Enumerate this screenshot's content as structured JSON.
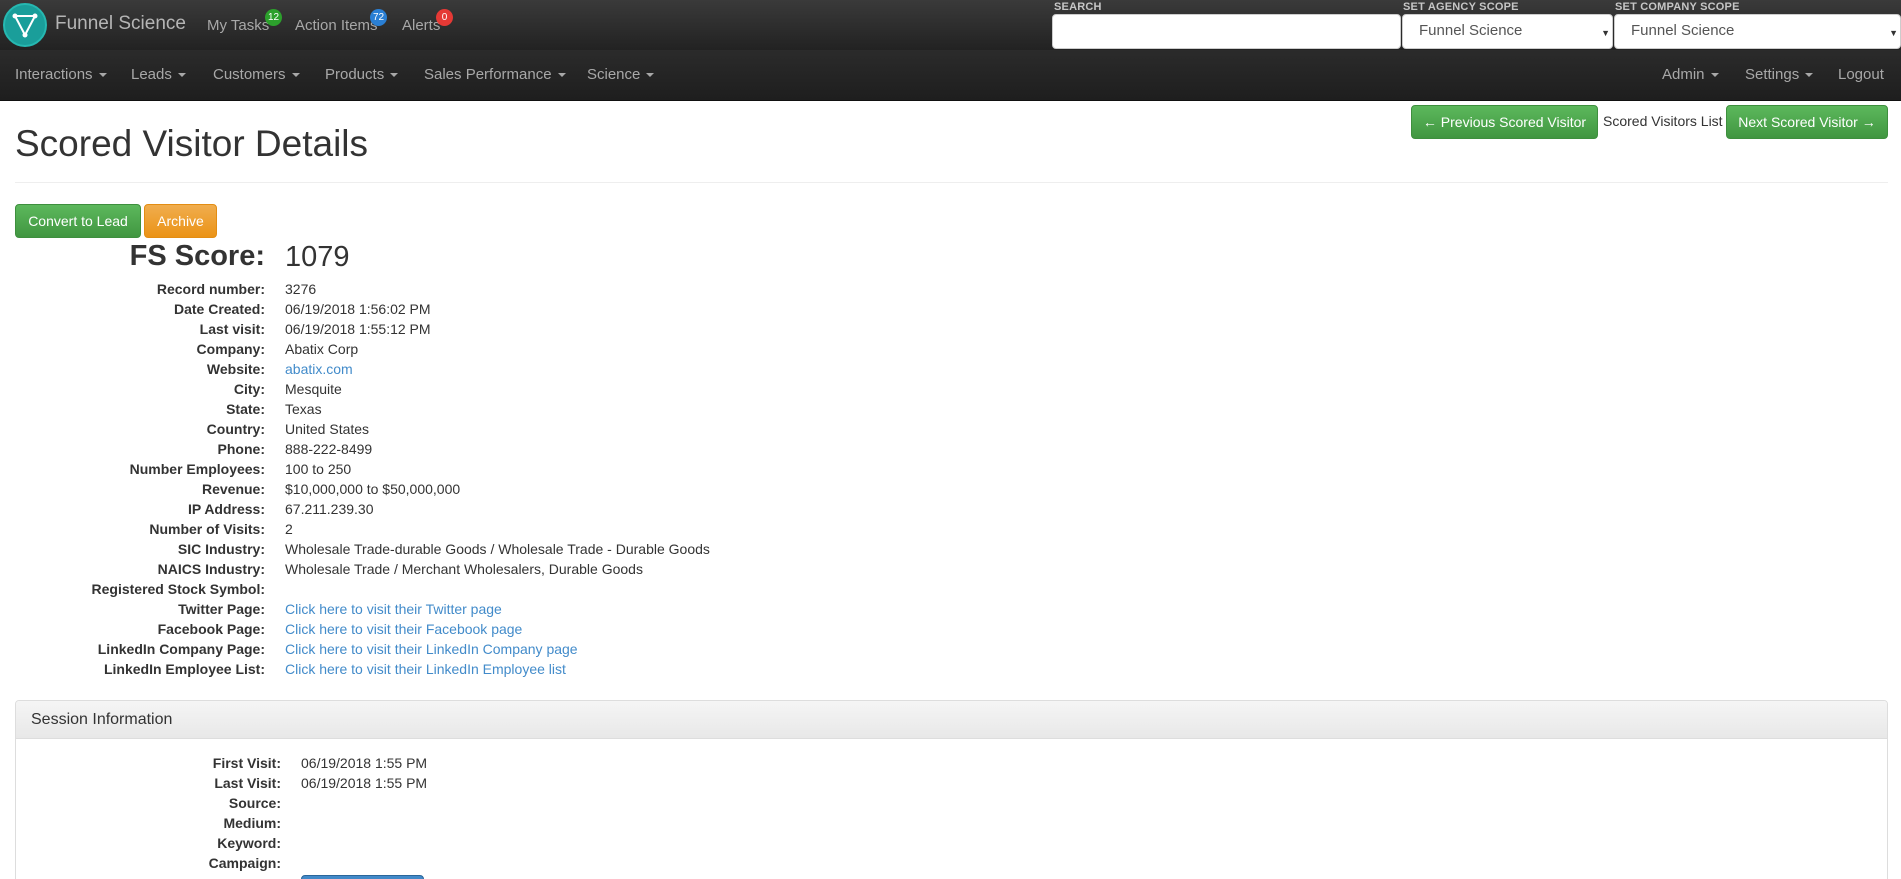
{
  "topbar": {
    "brand": "Funnel Science",
    "links": [
      {
        "label": "My Tasks",
        "badge": "12",
        "badge_color": "#2ca02c"
      },
      {
        "label": "Action Items",
        "badge": "72",
        "badge_color": "#2a7fd4"
      },
      {
        "label": "Alerts",
        "badge": "0",
        "badge_color": "#e53935"
      }
    ],
    "search_label": "SEARCH",
    "search_value": "",
    "agency_scope_label": "SET AGENCY SCOPE",
    "agency_scope_value": "Funnel Science",
    "company_scope_label": "SET COMPANY SCOPE",
    "company_scope_value": "Funnel Science"
  },
  "nav": {
    "items": [
      "Interactions",
      "Leads",
      "Customers",
      "Products",
      "Sales Performance",
      "Science"
    ],
    "right_items": [
      "Admin",
      "Settings"
    ],
    "logout": "Logout"
  },
  "header": {
    "title": "Scored Visitor Details",
    "prev_button": "← Previous Scored Visitor",
    "list_label": "Scored Visitors List",
    "next_button": "Next Scored Visitor →"
  },
  "actions": {
    "convert": "Convert to Lead",
    "archive": "Archive"
  },
  "score": {
    "label": "FS Score:",
    "value": "1079"
  },
  "details": [
    {
      "label": "Record number:",
      "value": "3276"
    },
    {
      "label": "Date Created:",
      "value": "06/19/2018 1:56:02 PM"
    },
    {
      "label": "Last visit:",
      "value": "06/19/2018 1:55:12 PM"
    },
    {
      "label": "Company:",
      "value": "Abatix Corp"
    },
    {
      "label": "Website:",
      "value": "abatix.com",
      "link": true
    },
    {
      "label": "City:",
      "value": "Mesquite"
    },
    {
      "label": "State:",
      "value": "Texas"
    },
    {
      "label": "Country:",
      "value": "United States"
    },
    {
      "label": "Phone:",
      "value": "888-222-8499"
    },
    {
      "label": "Number Employees:",
      "value": "100 to 250"
    },
    {
      "label": "Revenue:",
      "value": "$10,000,000 to $50,000,000"
    },
    {
      "label": "IP Address:",
      "value": "67.211.239.30"
    },
    {
      "label": "Number of Visits:",
      "value": "2"
    },
    {
      "label": "SIC Industry:",
      "value": "Wholesale Trade-durable Goods / Wholesale Trade - Durable Goods"
    },
    {
      "label": "NAICS Industry:",
      "value": "Wholesale Trade / Merchant Wholesalers, Durable Goods"
    },
    {
      "label": "Registered Stock Symbol:",
      "value": ""
    },
    {
      "label": "Twitter Page:",
      "value": "Click here to visit their Twitter page",
      "link": true
    },
    {
      "label": "Facebook Page:",
      "value": "Click here to visit their Facebook page",
      "link": true
    },
    {
      "label": "LinkedIn Company Page:",
      "value": "Click here to visit their LinkedIn Company page",
      "link": true
    },
    {
      "label": "LinkedIn Employee List:",
      "value": "Click here to visit their LinkedIn Employee list",
      "link": true
    }
  ],
  "session": {
    "title": "Session Information",
    "rows": [
      {
        "label": "First Visit:",
        "value": "06/19/2018 1:55 PM"
      },
      {
        "label": "Last Visit:",
        "value": "06/19/2018 1:55 PM"
      },
      {
        "label": "Source:",
        "value": ""
      },
      {
        "label": "Medium:",
        "value": ""
      },
      {
        "label": "Keyword:",
        "value": ""
      },
      {
        "label": "Campaign:",
        "value": ""
      }
    ]
  }
}
